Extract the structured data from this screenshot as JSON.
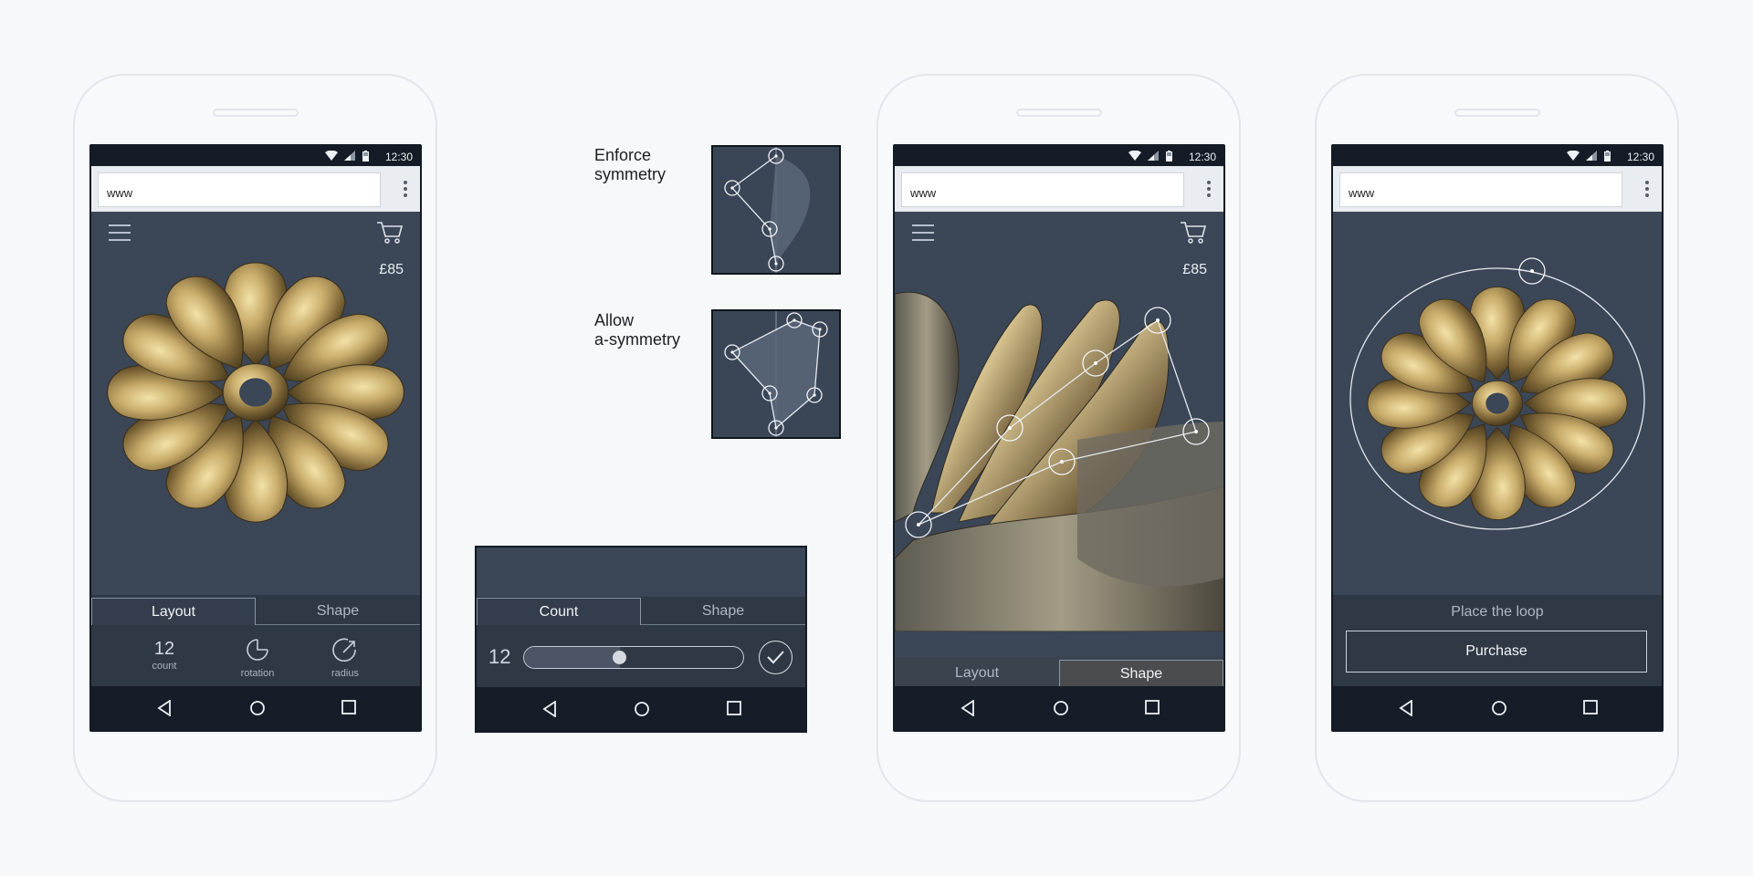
{
  "status": {
    "time": "12:30"
  },
  "browser": {
    "url": "www"
  },
  "cart": {
    "price": "£85"
  },
  "phone1": {
    "tabs": [
      "Layout",
      "Shape"
    ],
    "active_tab": "Layout",
    "tools": [
      {
        "value": "12",
        "label": "count",
        "icon": "count-value"
      },
      {
        "label": "rotation",
        "icon": "rotation-icon"
      },
      {
        "label": "radius",
        "icon": "radius-icon"
      }
    ]
  },
  "symmetry": {
    "enforce": {
      "line1": "Enforce",
      "line2": "symmetry"
    },
    "allow": {
      "line1": "Allow",
      "line2": "a-symmetry"
    }
  },
  "count_panel": {
    "tabs": [
      "Count",
      "Shape"
    ],
    "active_tab": "Count",
    "value": "12",
    "slider_fraction": 0.42,
    "confirm_icon": "check-icon"
  },
  "phone3": {
    "tabs": [
      "Layout",
      "Shape"
    ],
    "active_tab": "Shape"
  },
  "phone4": {
    "hint": "Place the loop",
    "button": "Purchase"
  },
  "colors": {
    "screen_bg": "#3b4656",
    "status_bar": "#151c27",
    "gold": "#c8ad6e",
    "page_bg": "#f6f8fa"
  }
}
